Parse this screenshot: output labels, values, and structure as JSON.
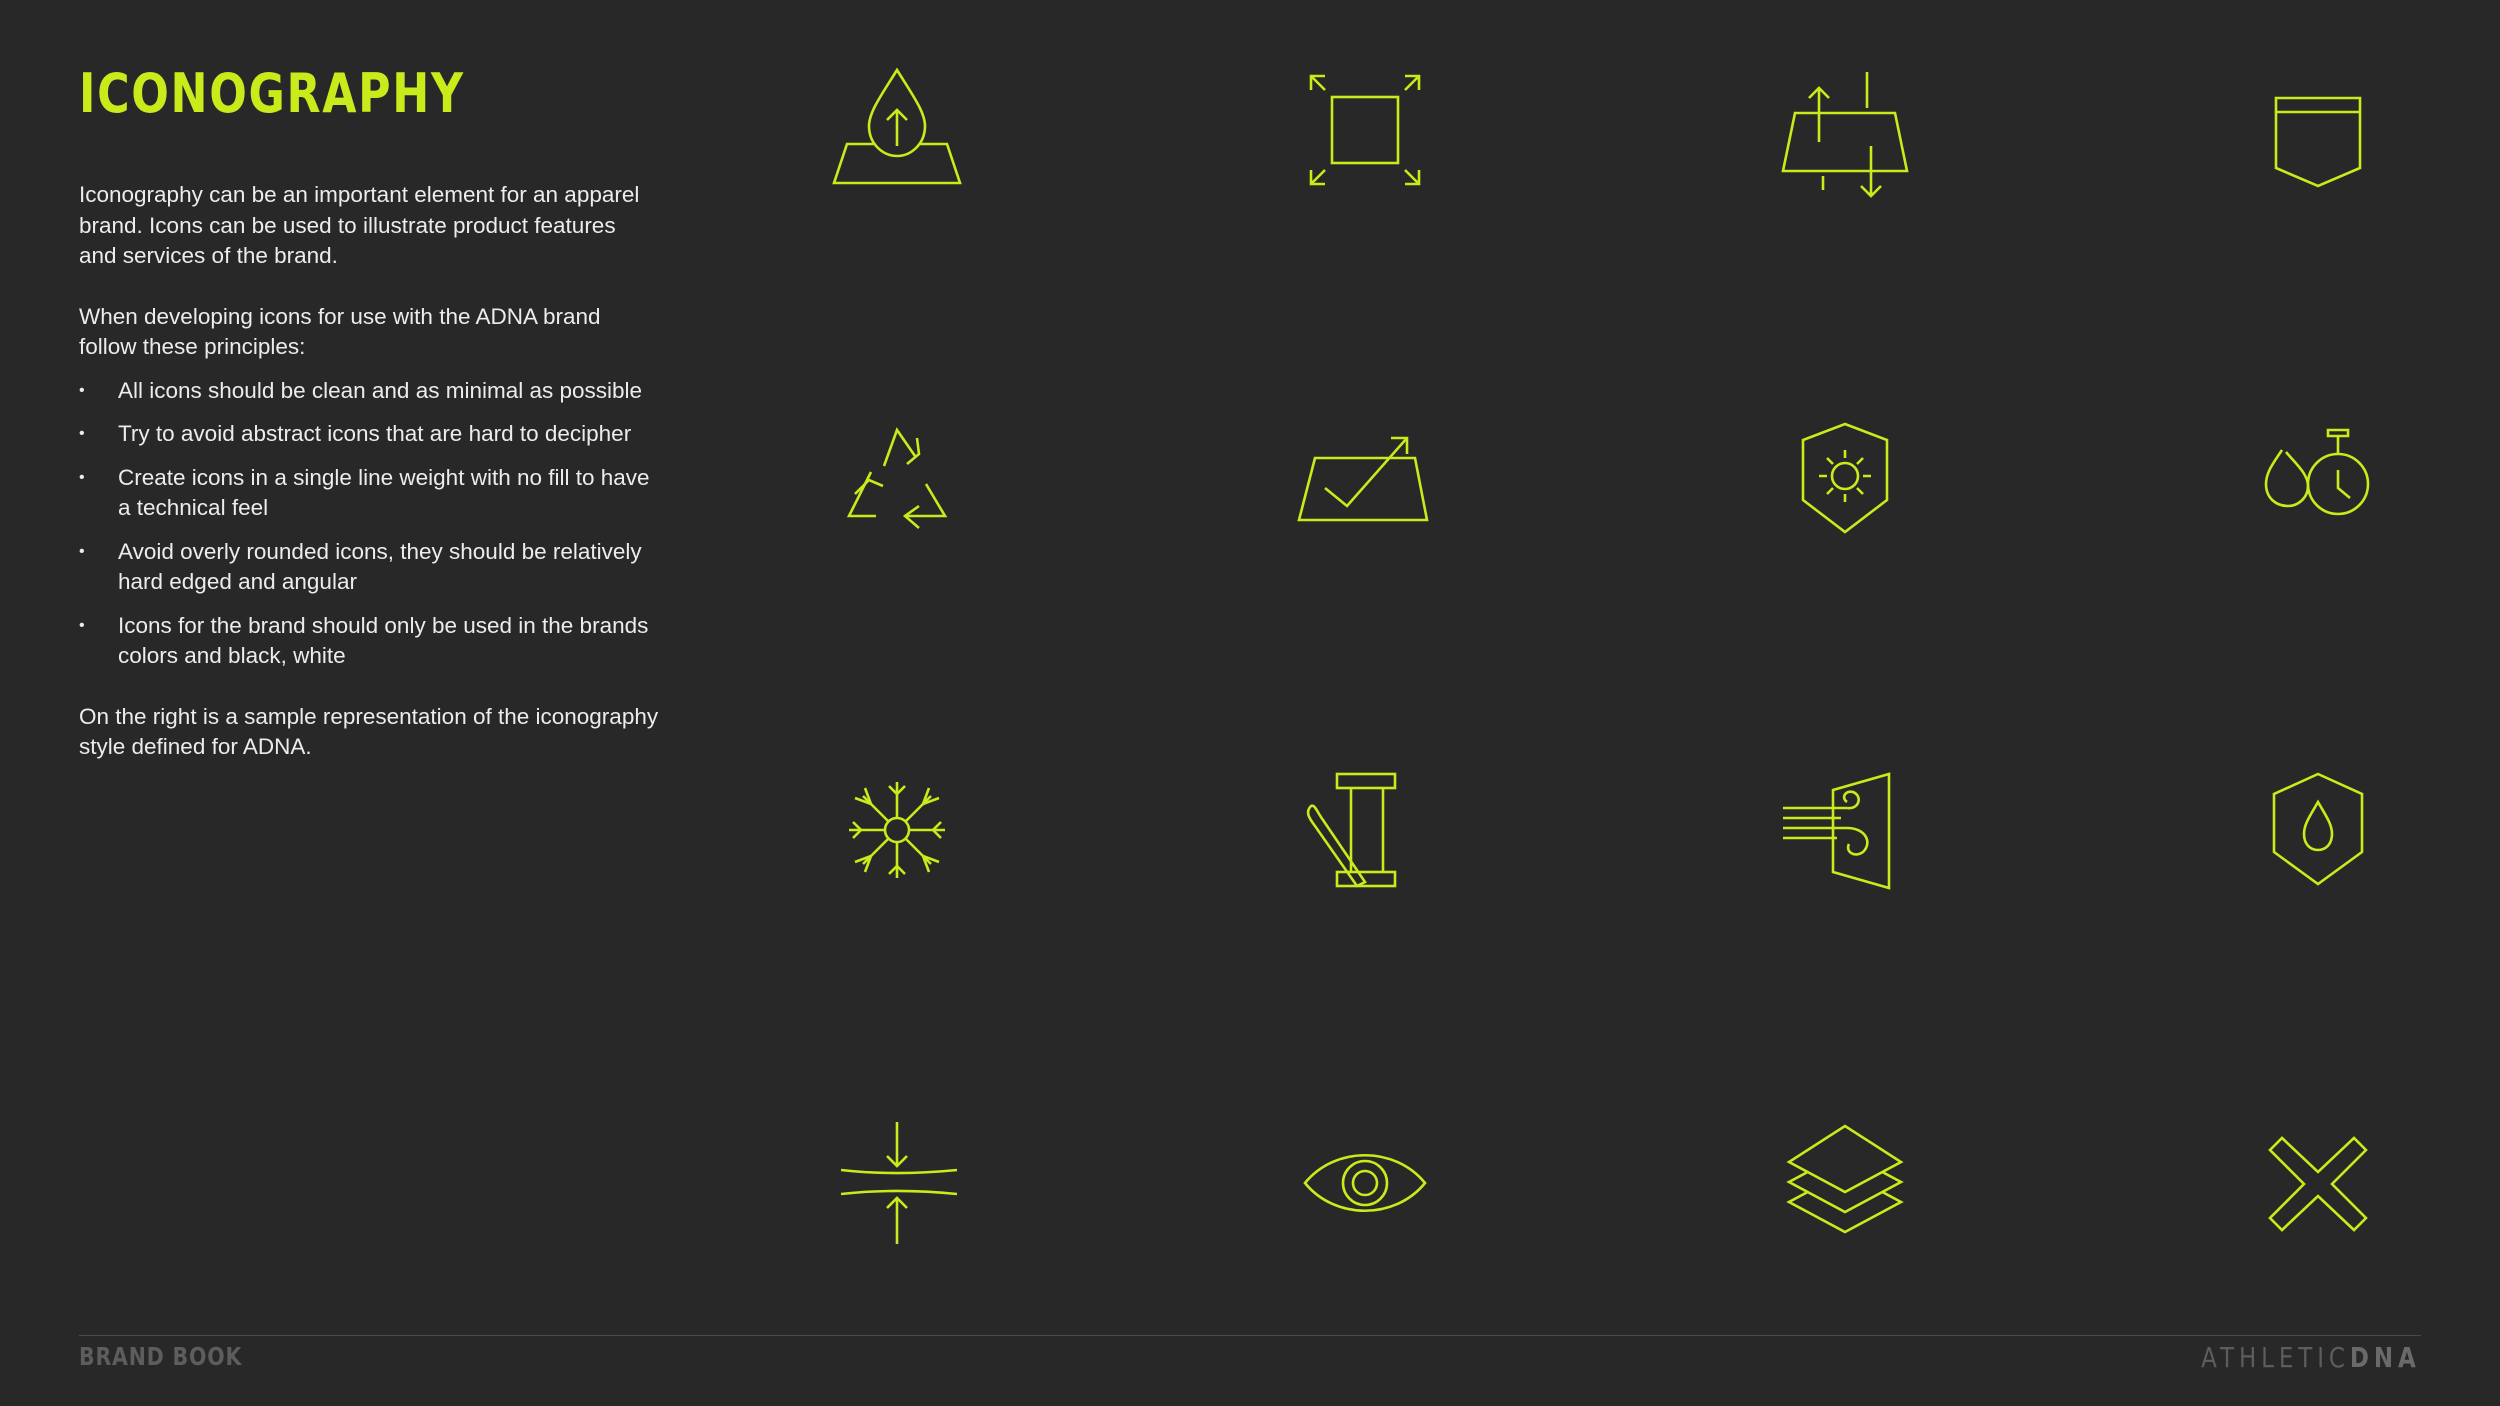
{
  "page": {
    "title": "ICONOGRAPHY"
  },
  "intro": {
    "para1": "Iconography can be an important element for an apparel brand. Icons can be used to illustrate product features and services of the brand.",
    "para2": "When developing icons for use with the ADNA brand follow these principles:",
    "bullets": [
      "All icons should be clean and as minimal as possible",
      "Try to avoid abstract icons that are hard to decipher",
      "Create icons in a single line weight with no fill to have a technical feel",
      "Avoid overly rounded icons, they should be relatively hard edged and angular",
      "Icons for the brand should only be used in the brands colors and black, white"
    ],
    "para3": "On the right is a sample representation of the iconography style defined for ADNA."
  },
  "icons": [
    "moisture-wicking-icon",
    "four-way-stretch-icon",
    "breathable-fabric-icon",
    "pocket-icon",
    "recycled-icon",
    "lightweight-fabric-icon",
    "uv-protection-icon",
    "quick-dry-icon",
    "cooling-icon",
    "sewing-thread-icon",
    "wind-resistant-icon",
    "water-resistant-icon",
    "compression-icon",
    "visibility-icon",
    "layering-icon",
    "anti-chafe-icon"
  ],
  "footer": {
    "left": "BRAND BOOK",
    "brand_light": "ATHLETIC",
    "brand_bold": "DNA"
  },
  "colors": {
    "background": "#282828",
    "accent": "#c8eb1b",
    "text": "#ececec",
    "footer": "#5d5d5d"
  }
}
